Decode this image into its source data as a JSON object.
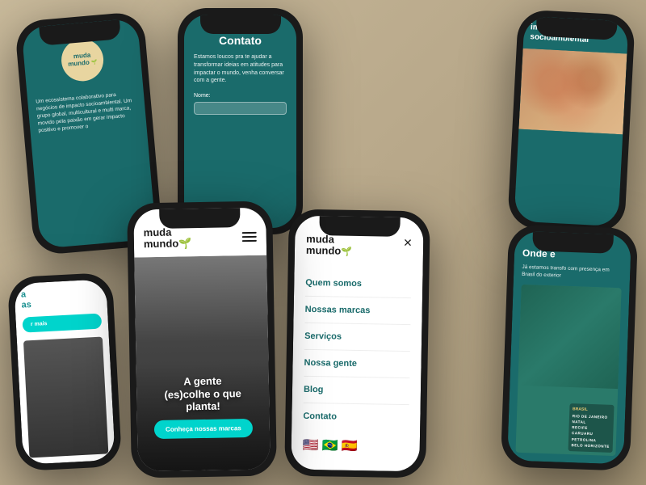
{
  "scene": {
    "background_color": "#c8b99a"
  },
  "phone1": {
    "logo_line1": "muda",
    "logo_line2": "mundo",
    "body_text": "Um ecossistema colaborativo para negócios de impacto socioambiental. Um grupo global, multicultural e multi marca, movido pela paixão em gerar impacto positivo e promover o"
  },
  "phone2": {
    "title": "Contato",
    "body": "Estamos loucos pra te ajudar a transformar ideias em atitudes para impactar o mundo, venha conversar com a gente.",
    "label_nome": "Nome:"
  },
  "phone3": {
    "title_line1": "imp",
    "title_line2": "socioambiental"
  },
  "phone4": {
    "teal_line1": "a",
    "teal_line2": "as",
    "btn_label": "r mais"
  },
  "phone5": {
    "logo_line1": "muda",
    "logo_line2": "mundo",
    "hero_title_line1": "A gente",
    "hero_title_line2": "(es)colhe o que",
    "hero_title_line3": "planta!",
    "btn_label": "Conheça nossas marcas"
  },
  "phone6": {
    "logo_line1": "muda",
    "logo_line2": "mundo",
    "close_icon": "×",
    "menu_items": [
      "Quem somos",
      "Nossas marcas",
      "Serviços",
      "Nossa gente",
      "Blog",
      "Contato"
    ]
  },
  "phone7": {
    "title": "Onde e",
    "body": "Já estamos transfo com presença em Brasil do exterior",
    "brazil_label": "BRASIL",
    "cities": [
      "RIO DE JANEIRO",
      "NATAL",
      "RECIFE",
      "CARUARU",
      "PETROLINA",
      "BELO HORIZONTE"
    ]
  }
}
